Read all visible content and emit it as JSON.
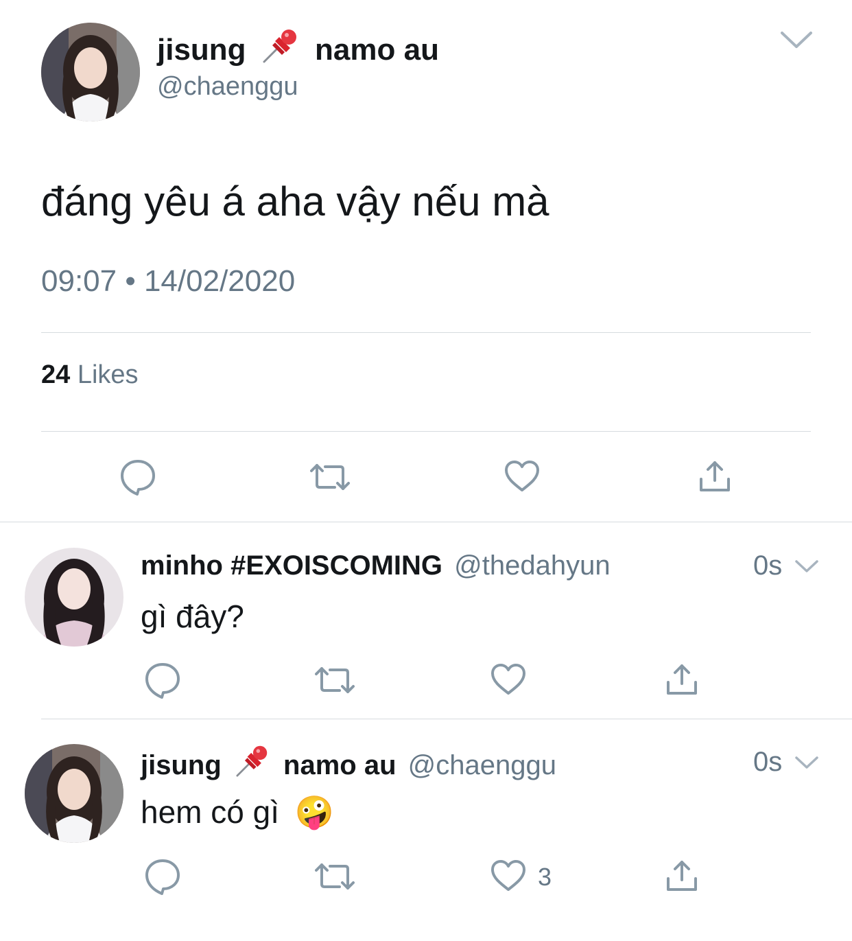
{
  "main_tweet": {
    "display_name_part1": "jisung",
    "display_name_part2": "namo au",
    "handle": "@chaenggu",
    "text": "đáng yêu á aha vậy nếu mà",
    "timestamp": "09:07 • 14/02/2020",
    "likes_count": "24",
    "likes_label": "Likes",
    "emoji_icon": "pushpin-icon"
  },
  "replies": [
    {
      "display_name": "minho #EXOISCOMING",
      "handle": "@thedahyun",
      "time": "0s",
      "text": "gì đây?",
      "like_count": ""
    },
    {
      "display_name_part1": "jisung",
      "display_name_part2": "namo au",
      "handle": "@chaenggu",
      "time": "0s",
      "text": "hem có gì",
      "emoji": "🤪",
      "like_count": "3"
    }
  ],
  "colors": {
    "text": "#14171a",
    "secondary": "#657786",
    "icon": "#8899a6",
    "divider": "#d6dbdf",
    "pin_red": "#d9232e"
  }
}
